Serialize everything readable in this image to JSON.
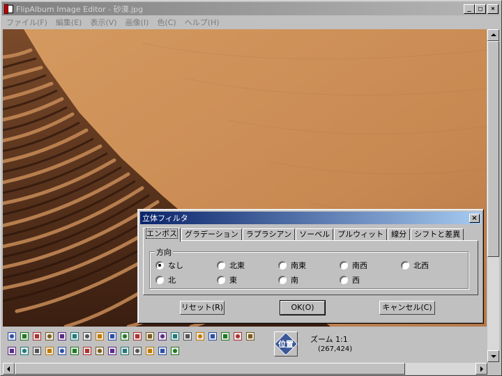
{
  "window": {
    "title": "FlipAlbum Image Editor - 砂漠.jpg"
  },
  "menu": [
    "ファイル(F)",
    "編集(E)",
    "表示(V)",
    "画像(I)",
    "色(C)",
    "ヘルプ(H)"
  ],
  "window_buttons": {
    "minimize": "_",
    "maximize": "□",
    "close": "×"
  },
  "image": {
    "subject": "desert sand dune"
  },
  "dialog": {
    "title": "立体フィルタ",
    "close": "×",
    "tabs": [
      "エンボス",
      "グラデーション",
      "ラプラシアン",
      "ソーベル",
      "プルウィット",
      "線分",
      "シフトと差異"
    ],
    "active_tab": "エンボス",
    "group_label": "方向",
    "directions": [
      {
        "label": "なし",
        "selected": true
      },
      {
        "label": "北東",
        "selected": false
      },
      {
        "label": "南東",
        "selected": false
      },
      {
        "label": "南西",
        "selected": false
      },
      {
        "label": "北西",
        "selected": false
      },
      {
        "label": "北",
        "selected": false
      },
      {
        "label": "東",
        "selected": false
      },
      {
        "label": "南",
        "selected": false
      },
      {
        "label": "西",
        "selected": false
      }
    ],
    "buttons": {
      "reset": "リセット(R)",
      "ok": "OK(O)",
      "cancel": "キャンセル(C)"
    }
  },
  "status": {
    "position_button": "位置",
    "zoom": "ズーム 1:1",
    "coords": "(267,424)"
  },
  "tool_icons": [
    "new-icon",
    "save-icon",
    "undo-icon",
    "rotate-left-icon",
    "crop-icon",
    "auto-crop-icon",
    "zoom-in-icon",
    "flip-icon",
    "rotate-icon",
    "text-icon",
    "color-palette-icon",
    "portrait-icon",
    "gradient-icon",
    "swap-icon",
    "sun-icon",
    "color-wheel-icon",
    "effects-icon",
    "scanner-icon",
    "print-icon",
    "copy-icon",
    "select-icon",
    "cut-icon",
    "zoom-icon",
    "zoom-out-icon",
    "resize-icon",
    "brush-icon",
    "flip-h-icon",
    "filter-icon",
    "grid-icon",
    "histogram-icon",
    "red-eye-fix-icon",
    "contrast-icon",
    "pen-icon",
    "eye-icon"
  ]
}
